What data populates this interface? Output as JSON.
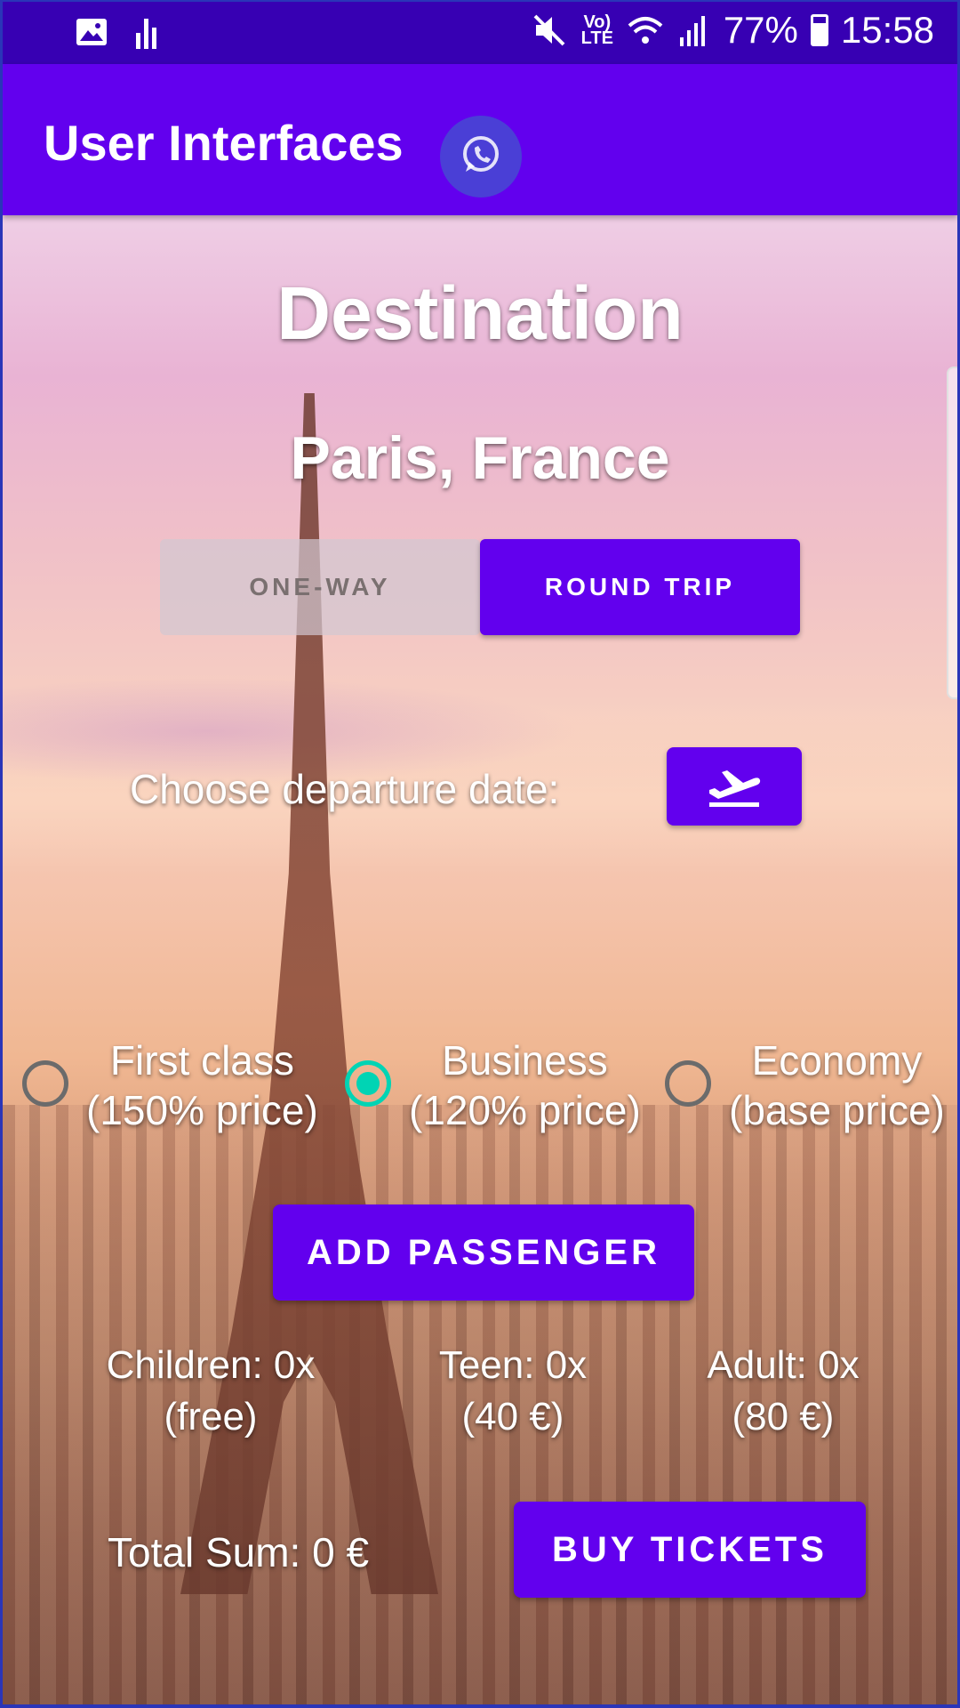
{
  "status_bar": {
    "volte_top": "Vo)",
    "volte_bottom": "LTE",
    "battery_percent": "77%",
    "time": "15:58",
    "icons": [
      "gallery-icon",
      "sound-level-icon",
      "mute-icon",
      "volte-icon",
      "wifi-icon",
      "signal-icon",
      "battery-icon"
    ]
  },
  "app_bar": {
    "title": "User Interfaces",
    "action_icon": "whatsapp-icon"
  },
  "main": {
    "heading": "Destination",
    "city": "Paris, France",
    "trip_type": {
      "options": [
        "ONE-WAY",
        "ROUND TRIP"
      ],
      "selected": "ROUND TRIP"
    },
    "departure_label": "Choose departure date:",
    "departure_icon": "flight-takeoff-icon",
    "class_options": [
      {
        "line1": "First class",
        "line2": "(150% price)",
        "checked": false
      },
      {
        "line1": "Business",
        "line2": "(120% price)",
        "checked": true
      },
      {
        "line1": "Economy",
        "line2": "(base price)",
        "checked": false
      }
    ],
    "add_passenger_label": "ADD PASSENGER",
    "passengers": [
      {
        "line1": "Children: 0x",
        "line2": "(free)"
      },
      {
        "line1": "Teen: 0x",
        "line2": "(40 €)"
      },
      {
        "line1": "Adult: 0x",
        "line2": "(80 €)"
      }
    ],
    "total_sum": "Total Sum: 0 €",
    "buy_label": "BUY TICKETS"
  },
  "colors": {
    "status_bar": "#3700b3",
    "primary": "#6200ee",
    "accent": "#00d4b4"
  }
}
